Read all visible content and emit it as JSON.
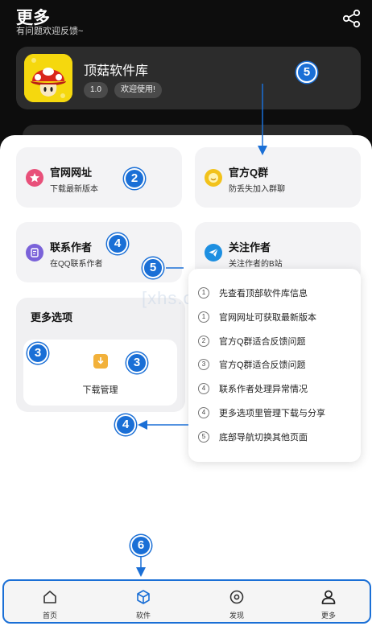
{
  "header": {
    "title": "更多",
    "subtitle": "有问题欢迎反馈~",
    "share_icon": "share-icon"
  },
  "app": {
    "name": "顶菇软件库",
    "version": "1.0",
    "welcome": "欢迎使用!",
    "icon": "mushroom-app-icon"
  },
  "cards": [
    {
      "title": "官网网址",
      "subtitle": "下载最新版本",
      "icon": "star-icon",
      "color": "#e8507a"
    },
    {
      "title": "官方Q群",
      "subtitle": "防丢失加入群聊",
      "icon": "smile-icon",
      "color": "#f2c21b"
    },
    {
      "title": "联系作者",
      "subtitle": "在QQ联系作者",
      "icon": "message-icon",
      "color": "#7a62d9"
    },
    {
      "title": "关注作者",
      "subtitle": "关注作者的B站",
      "icon": "paper-plane-icon",
      "color": "#1d8fe1"
    }
  ],
  "more": {
    "title": "更多选项",
    "download_label": "下载管理",
    "download_icon": "download-folder-icon"
  },
  "popup": {
    "items": [
      {
        "num": "1",
        "text": "先查看顶部软件库信息"
      },
      {
        "num": "1",
        "text": "官网网址可获取最新版本"
      },
      {
        "num": "2",
        "text": "官方Q群适合反馈问题"
      },
      {
        "num": "3",
        "text": "官方Q群适合反馈问题"
      },
      {
        "num": "4",
        "text": "联系作者处理异常情况"
      },
      {
        "num": "4",
        "text": "更多选项里管理下载与分享"
      },
      {
        "num": "5",
        "text": "底部导航切换其他页面"
      }
    ]
  },
  "badges": {
    "b5_top": "5",
    "b2": "2",
    "b4_card": "4",
    "b5_mid": "5",
    "b3_left": "3",
    "b3_dl": "3",
    "b4_bottom": "4",
    "b6": "6"
  },
  "watermark": "[xhs.co",
  "nav": [
    {
      "label": "首页",
      "icon": "home-icon"
    },
    {
      "label": "软件",
      "icon": "cube-icon",
      "active": true
    },
    {
      "label": "发现",
      "icon": "compass-icon"
    },
    {
      "label": "更多",
      "icon": "person-icon"
    }
  ],
  "colors": {
    "accent": "#1a6fd6",
    "header_bg": "#0d0d0d",
    "app_icon_bg": "#f5d80e"
  }
}
